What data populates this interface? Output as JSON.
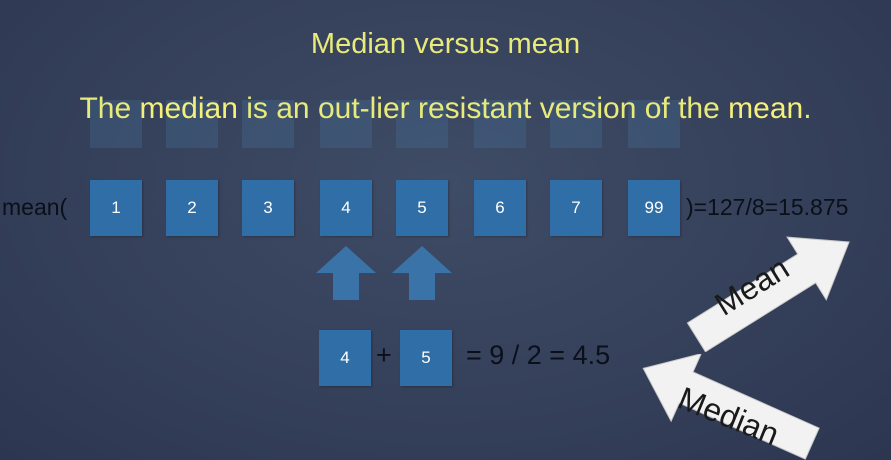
{
  "slide": {
    "title": "Median versus mean",
    "subtitle_parts": [
      "The ",
      "median",
      " is an out-lier resistant version of the ",
      "mean",
      "."
    ]
  },
  "mean_row": {
    "label": "mean(",
    "values": [
      "1",
      "2",
      "3",
      "4",
      "5",
      "6",
      "7",
      "99"
    ],
    "result": ")=127/8=15.875"
  },
  "median_row": {
    "left_value": "4",
    "plus": "+",
    "right_value": "5",
    "result": "= 9 / 2 = 4.5"
  },
  "callouts": {
    "mean": "Mean",
    "median": "Median"
  },
  "colors": {
    "background": "#35405a",
    "title": "#e8ea7a",
    "box": "#2f6ea6",
    "arrow": "#3a73a8",
    "callout": "#f2f2f2"
  },
  "icons": [
    "up-arrow-icon",
    "arrow-callout-icon"
  ]
}
